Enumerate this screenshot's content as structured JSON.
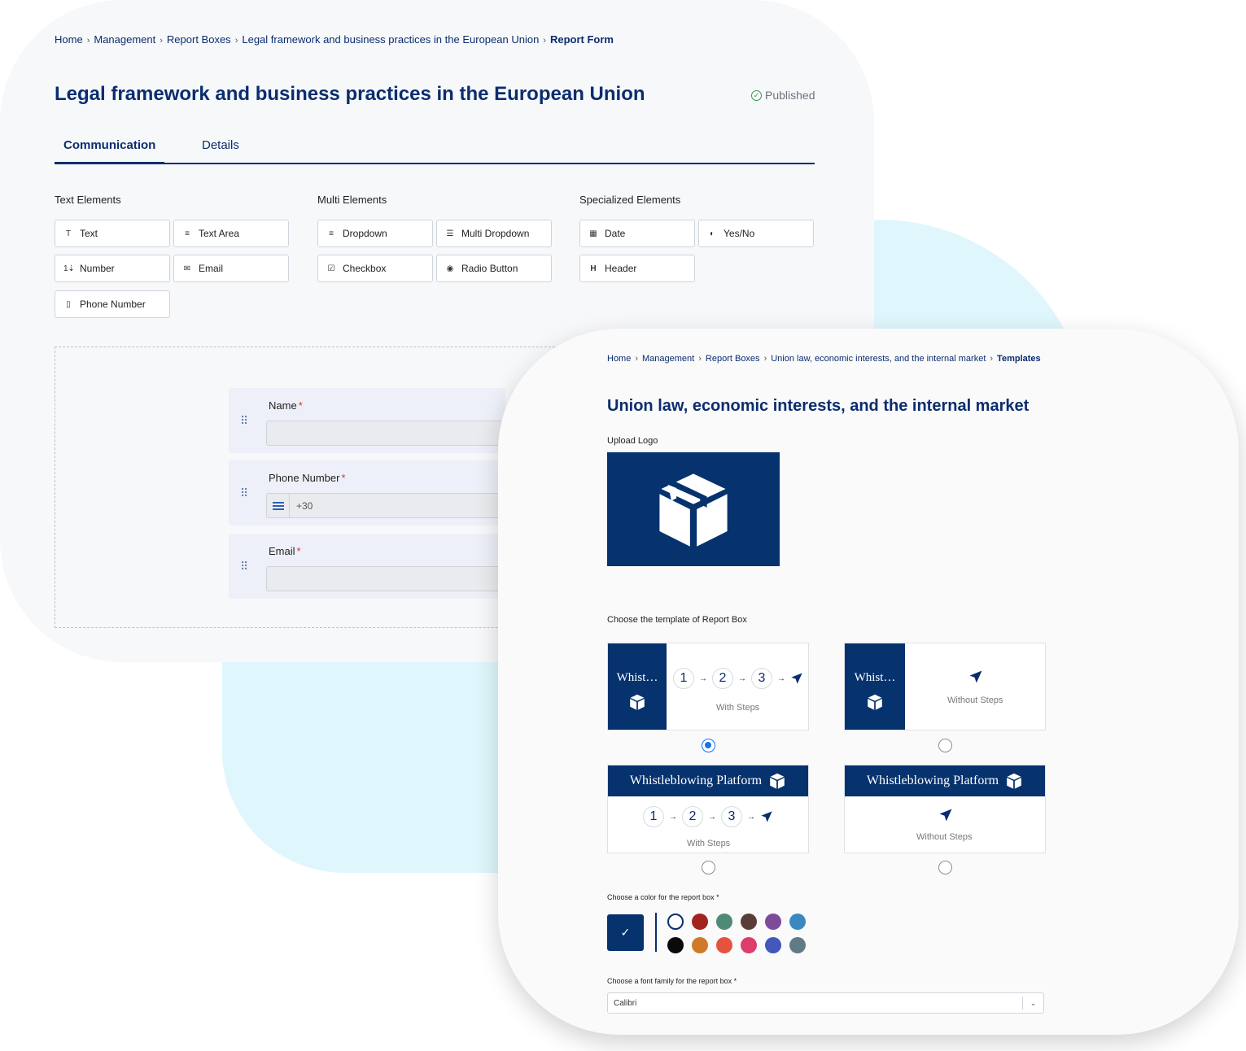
{
  "back": {
    "breadcrumb": [
      "Home",
      "Management",
      "Report Boxes",
      "Legal framework and business practices in the European Union",
      "Report Form"
    ],
    "title": "Legal framework and business practices in the European Union",
    "status": "Published",
    "tabs": [
      "Communication",
      "Details"
    ],
    "groups": {
      "text": "Text Elements",
      "multi": "Multi Elements",
      "special": "Specialized Elements"
    },
    "elements": {
      "text": "Text",
      "textarea": "Text Area",
      "number": "Number",
      "email": "Email",
      "phone": "Phone Number",
      "dropdown": "Dropdown",
      "multi_dropdown": "Multi Dropdown",
      "checkbox": "Checkbox",
      "radio": "Radio Button",
      "date": "Date",
      "yesno": "Yes/No",
      "header": "Header"
    },
    "fields": [
      {
        "label": "Name",
        "req": "*",
        "value": ""
      },
      {
        "label": "Phone Number",
        "req": "*",
        "value": "+30"
      },
      {
        "label": "Email",
        "req": "*",
        "value": ""
      }
    ]
  },
  "front": {
    "breadcrumb": [
      "Home",
      "Management",
      "Report Boxes",
      "Union law, economic interests, and the internal market",
      "Templates"
    ],
    "title": "Union law, economic interests, and the internal market",
    "upload_label": "Upload Logo",
    "template_label": "Choose the template of Report Box",
    "templates": {
      "side_short": "Whist…",
      "header_full": "Whistleblowing Platform",
      "with_steps": "With Steps",
      "without_steps": "Without Steps",
      "steps": [
        "1",
        "2",
        "3"
      ],
      "selected_index": 0
    },
    "color_label": "Choose a color for the report box *",
    "colors": {
      "selected": "#06326e",
      "row1": [
        "#ffffff",
        "#a3241f",
        "#4f8a76",
        "#5a3c3a",
        "#7e4a9c",
        "#3a88c0"
      ],
      "row2": [
        "#0a0a0a",
        "#cf7a2a",
        "#e5533f",
        "#dd3d6b",
        "#4457bb",
        "#627a86"
      ]
    },
    "font_label": "Choose a font family for the report box *",
    "font_value": "Calibri"
  }
}
